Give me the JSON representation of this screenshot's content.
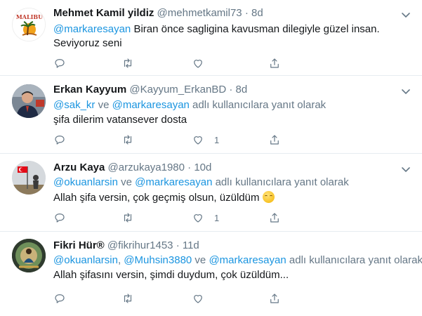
{
  "tweets": [
    {
      "name": "Mehmet Kamil yildiz",
      "handle": "@mehmetkamil73",
      "sep": "·",
      "time": "8d",
      "mention": "@markaresayan",
      "text1": " Biran önce sagligina kavusman dilegiyle güzel insan.",
      "text2": "Seviyoruz seni",
      "avatar_text": "MALIBU",
      "reply_count": "",
      "like_count": ""
    },
    {
      "name": "Erkan Kayyum",
      "handle": "@Kayyum_ErkanBD",
      "sep": "·",
      "time": "8d",
      "mention1": "@sak_kr",
      "and": " ve ",
      "mention2": "@markaresayan",
      "reply_suffix": " adlı kullanıcılara yanıt olarak",
      "text": "şifa dilerim vatansever dosta",
      "like_count": "1"
    },
    {
      "name": "Arzu Kaya",
      "handle": "@arzukaya1980",
      "sep": "·",
      "time": "10d",
      "mention1": "@okuanlarsin",
      "and": " ve ",
      "mention2": "@markaresayan",
      "reply_suffix": " adlı kullanıcılara yanıt olarak",
      "text": "Allah şifa versin, çok geçmiş olsun, üzüldüm ",
      "like_count": "1"
    },
    {
      "name": "Fikri Hür®",
      "handle": "@fikrihur1453",
      "sep": "·",
      "time": "11d",
      "mention1": "@okuanlarsin",
      "mention2": "@Muhsin3880",
      "and": " ve ",
      "mention3": "@markaresayan",
      "reply_suffix": " adlı kullanıcılara yanıt olarak",
      "text": "Allah şifasını versin, şimdi duydum, çok üzüldüm..."
    }
  ],
  "icons": [
    "reply-icon",
    "retweet-icon",
    "like-icon",
    "share-icon",
    "caret-down-icon"
  ],
  "colors": {
    "link": "#1b95e0",
    "muted": "#657786",
    "text": "#14171a",
    "border": "#e6ecf0"
  }
}
